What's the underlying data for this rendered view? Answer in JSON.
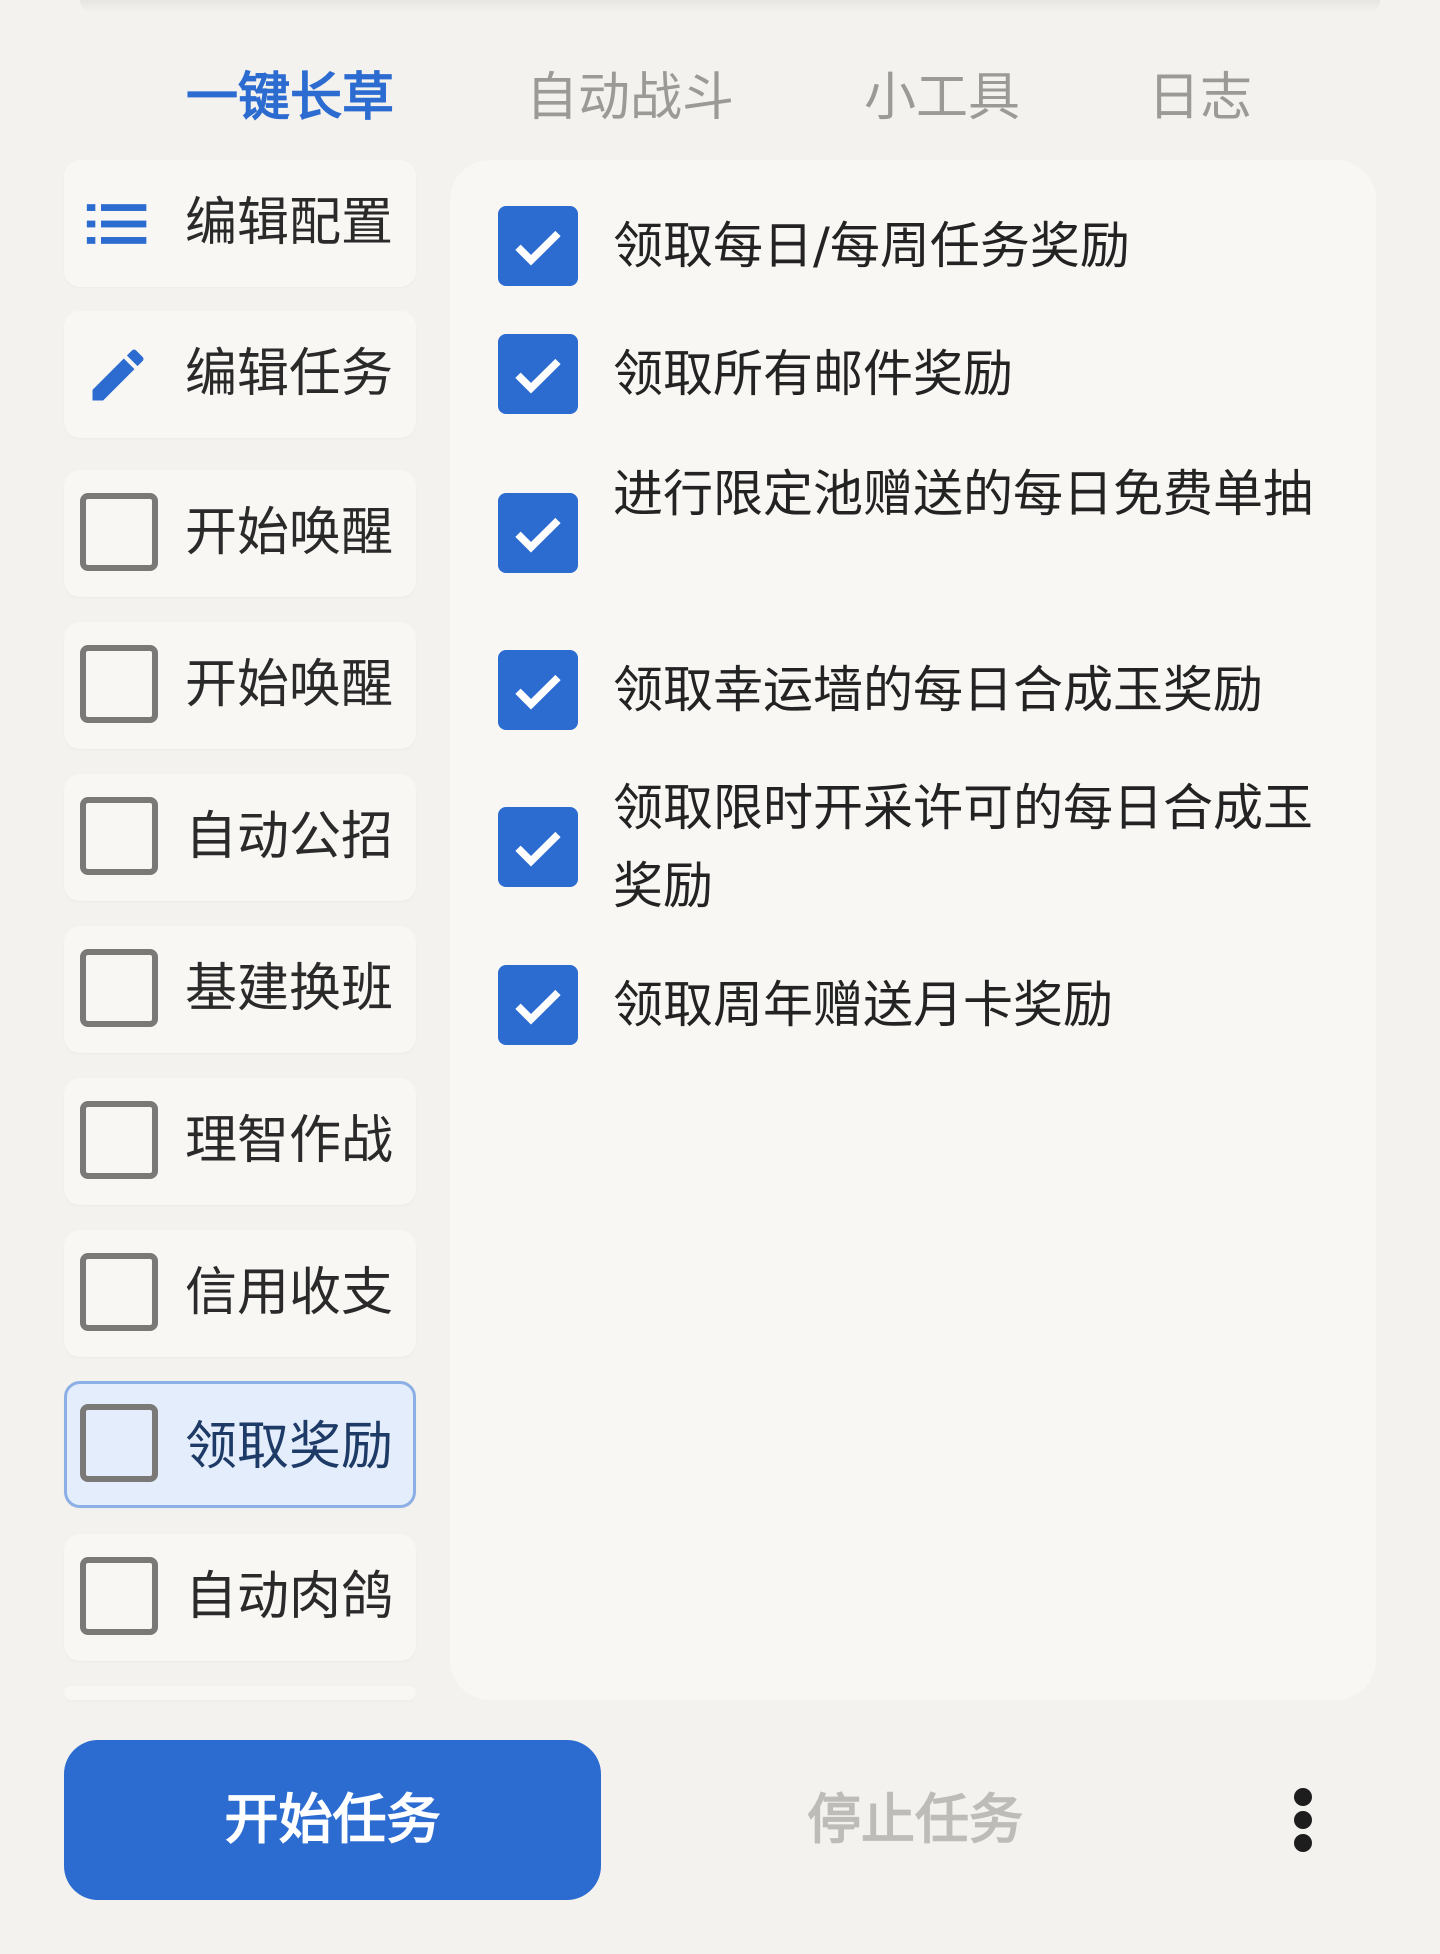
{
  "tabs": [
    {
      "label": "一键长草",
      "active": true
    },
    {
      "label": "自动战斗",
      "active": false
    },
    {
      "label": "小工具",
      "active": false
    },
    {
      "label": "日志",
      "active": false
    }
  ],
  "sidebar": {
    "actions": [
      {
        "label": "编辑配置",
        "icon": "list-icon"
      },
      {
        "label": "编辑任务",
        "icon": "pencil-icon"
      }
    ],
    "tasks": [
      {
        "label": "开始唤醒",
        "checked": false,
        "selected": false
      },
      {
        "label": "开始唤醒",
        "checked": false,
        "selected": false
      },
      {
        "label": "自动公招",
        "checked": false,
        "selected": false
      },
      {
        "label": "基建换班",
        "checked": false,
        "selected": false
      },
      {
        "label": "理智作战",
        "checked": false,
        "selected": false
      },
      {
        "label": "信用收支",
        "checked": false,
        "selected": false
      },
      {
        "label": "领取奖励",
        "checked": false,
        "selected": true
      },
      {
        "label": "自动肉鸽",
        "checked": false,
        "selected": false
      }
    ]
  },
  "options": [
    {
      "label": "领取每日/每周任务奖励",
      "checked": true
    },
    {
      "label": "领取所有邮件奖励",
      "checked": true
    },
    {
      "label": "进行限定池赠送的每日免费单抽",
      "checked": true
    },
    {
      "label": "领取幸运墙的每日合成玉奖励",
      "checked": true
    },
    {
      "label": "领取限时开采许可的每日合成玉奖励",
      "checked": true
    },
    {
      "label": "领取周年赠送月卡奖励",
      "checked": true
    }
  ],
  "footer": {
    "start_label": "开始任务",
    "stop_label": "停止任务",
    "more_icon": "more-vertical-icon"
  },
  "colors": {
    "accent": "#2c6cd0",
    "background": "#f3f2ef",
    "card": "#f8f7f4",
    "selected_bg": "#e3edfb",
    "disabled_text": "#bdbcb9"
  }
}
